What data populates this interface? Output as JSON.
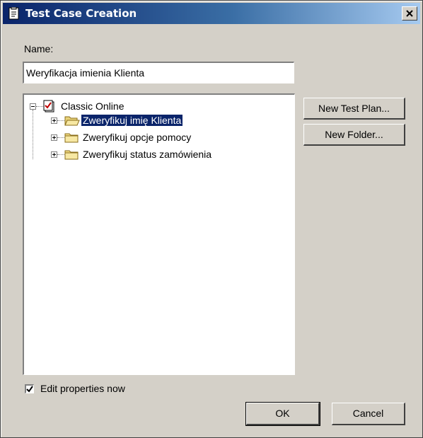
{
  "window": {
    "title": "Test Case Creation"
  },
  "name_field": {
    "label": "Name:",
    "value": "Weryfikacja imienia Klienta"
  },
  "tree": {
    "root": "Classic Online",
    "items": [
      {
        "label": "Zweryfikuj imię Klienta",
        "selected": true,
        "open": true
      },
      {
        "label": "Zweryfikuj opcje pomocy",
        "selected": false,
        "open": false
      },
      {
        "label": "Zweryfikuj status zamówienia",
        "selected": false,
        "open": false
      }
    ]
  },
  "buttons": {
    "new_test_plan": "New Test Plan...",
    "new_folder": "New Folder...",
    "ok": "OK",
    "cancel": "Cancel"
  },
  "edit_properties": {
    "label": "Edit properties now",
    "checked": true
  }
}
